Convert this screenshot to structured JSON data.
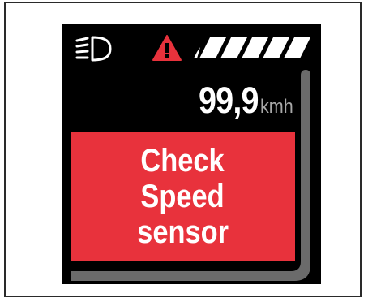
{
  "display": {
    "speed": {
      "value": "99,9",
      "unit": "kmh"
    },
    "alert": {
      "lines": [
        "Check",
        "Speed",
        "sensor"
      ]
    },
    "battery": {
      "segments": 5,
      "filled": 5
    },
    "indicators": {
      "headlight": "headlight-icon",
      "warning": "warning-triangle-icon"
    }
  },
  "colors": {
    "screen_bg": "#000000",
    "alert_bg": "#e8323c",
    "warning": "#e8323c",
    "text_primary": "#ffffff",
    "text_unit": "#a8a8a8",
    "gauge": "#6b6b6b"
  }
}
